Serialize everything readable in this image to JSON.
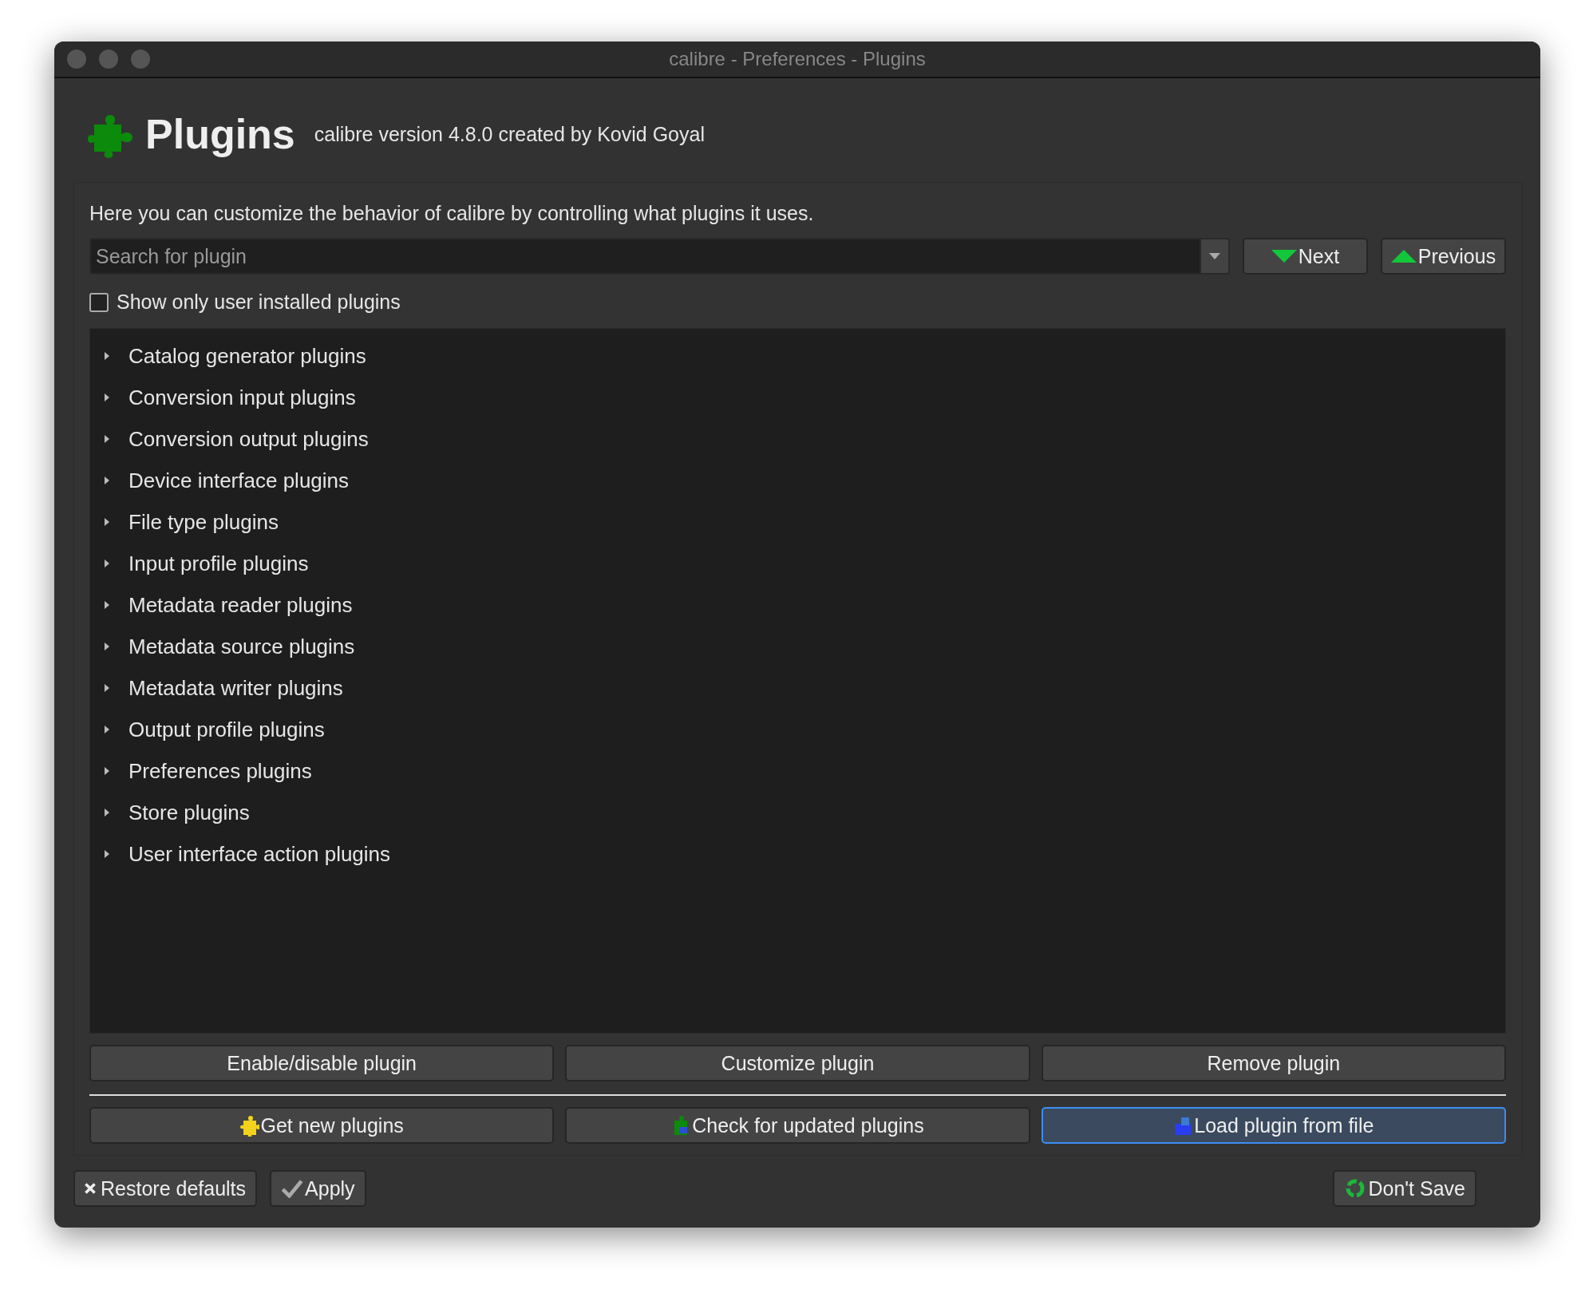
{
  "window": {
    "title": "calibre - Preferences - Plugins"
  },
  "header": {
    "title": "Plugins",
    "subtitle": "calibre version 4.8.0 created by Kovid Goyal"
  },
  "description": "Here you can customize the behavior of calibre by controlling what plugins it uses.",
  "search": {
    "placeholder": "Search for plugin"
  },
  "nav_buttons": [
    "Next",
    "Previous"
  ],
  "user_only": {
    "label": "Show only user installed plugins",
    "checked": false
  },
  "tree": [
    {
      "label": "Catalog generator plugins",
      "expanded": false
    },
    {
      "label": "Conversion input plugins",
      "expanded": false
    },
    {
      "label": "Conversion output plugins",
      "expanded": false
    },
    {
      "label": "Device interface plugins",
      "expanded": false
    },
    {
      "label": "File type plugins",
      "expanded": false
    },
    {
      "label": "Input profile plugins",
      "expanded": false
    },
    {
      "label": "Metadata reader plugins",
      "expanded": false
    },
    {
      "label": "Metadata source plugins",
      "expanded": false
    },
    {
      "label": "Metadata writer plugins",
      "expanded": false
    },
    {
      "label": "Output profile plugins",
      "expanded": false
    },
    {
      "label": "Preferences plugins",
      "expanded": false
    },
    {
      "label": "Store plugins",
      "expanded": false
    },
    {
      "label": "User interface action plugins",
      "expanded": false
    }
  ],
  "plugin_buttons": [
    "Enable/disable plugin",
    "Customize plugin",
    "Remove plugin"
  ],
  "action_buttons": [
    {
      "label": "Get new plugins",
      "focused": false
    },
    {
      "label": "Check for updated plugins",
      "focused": false
    },
    {
      "label": "Load plugin from file",
      "focused": true
    }
  ],
  "footer_buttons": [
    "Restore defaults",
    "Apply",
    "Don't Save"
  ]
}
